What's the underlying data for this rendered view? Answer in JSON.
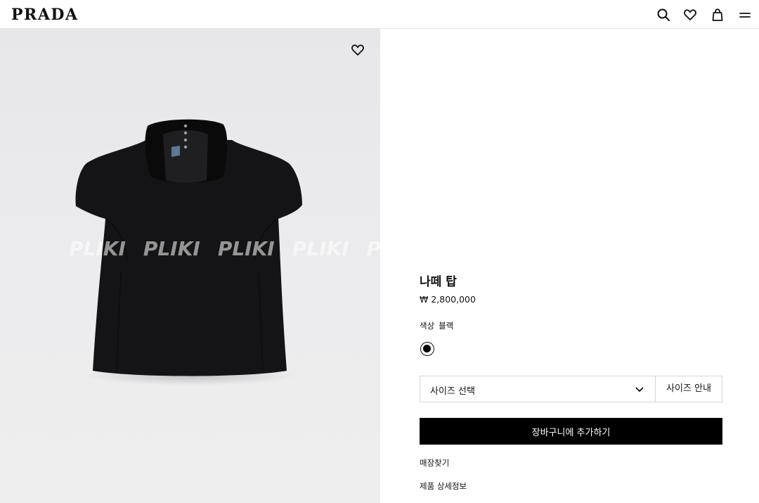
{
  "header": {
    "brand": "PRADA",
    "icons": [
      "search-icon",
      "heart-icon",
      "shopping-bag-icon",
      "menu-icon"
    ]
  },
  "image": {
    "watermark": [
      "PLIKI",
      "PLIKI",
      "PLIKI",
      "PLIKI",
      "PLIKI"
    ],
    "wishlist_icon": "heart-icon"
  },
  "product": {
    "name": "나떼 탑",
    "price": "₩ 2,800,000",
    "color_label": "색상",
    "color_value": "블랙",
    "swatch_color": "#000000"
  },
  "actions": {
    "size_select": "사이즈 선택",
    "size_guide": "사이즈 안내",
    "add_to_cart": "장바구니에 추가하기",
    "find_store": "매장찾기",
    "product_details": "제품 상세정보"
  }
}
